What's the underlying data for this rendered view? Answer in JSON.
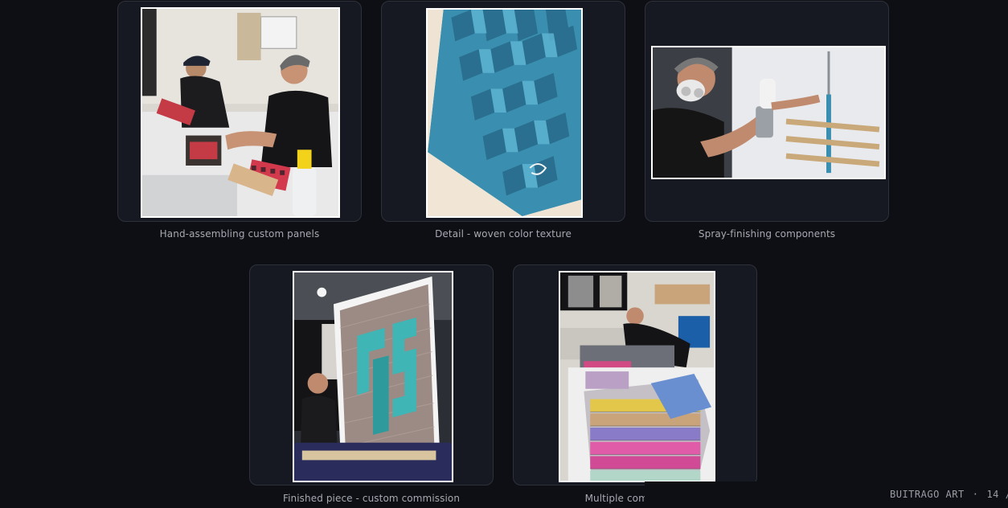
{
  "gallery": {
    "items": [
      {
        "caption": "Hand-assembling custom panels",
        "icon": "workshop-photo"
      },
      {
        "caption": "Detail - woven color texture",
        "icon": "texture-photo"
      },
      {
        "caption": "Spray-finishing components",
        "icon": "spray-photo"
      },
      {
        "caption": "Finished piece - custom commission",
        "icon": "finished-piece-photo"
      },
      {
        "caption": "Multiple commission",
        "icon": "multiple-commission-photo"
      }
    ]
  },
  "footer": {
    "brand": "BUITRAGO ART",
    "separator": "·",
    "page": "14 /"
  },
  "colors": {
    "background": "#0e0f14",
    "card": "#171922",
    "card_border": "#2e313b",
    "caption": "#a6a9b2"
  }
}
